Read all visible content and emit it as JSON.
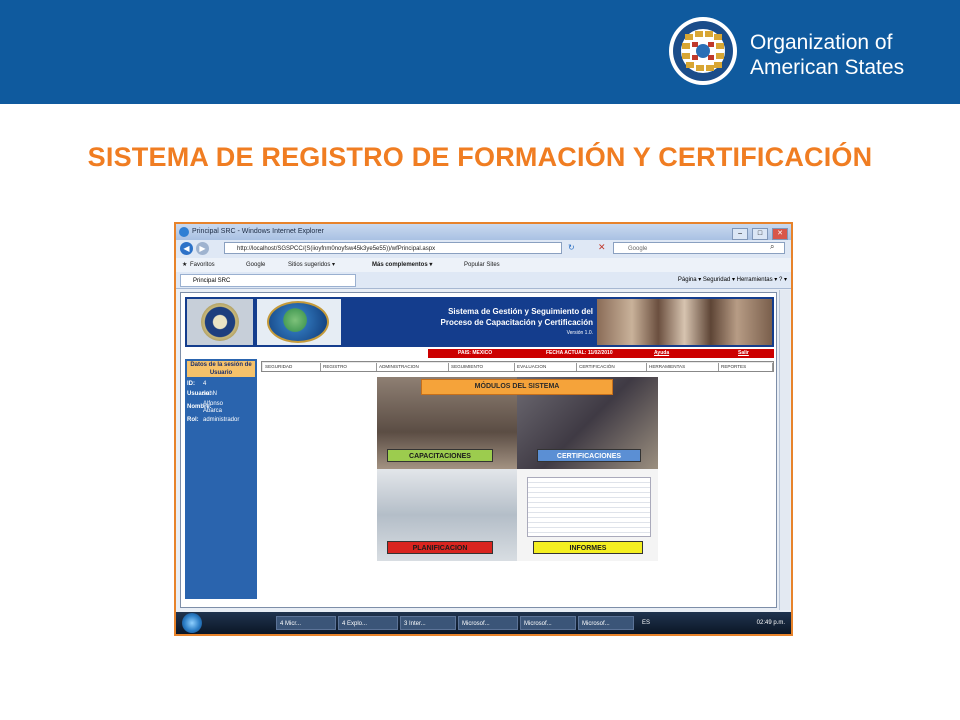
{
  "banner": {
    "org_line1": "Organization of",
    "org_line2": "American States"
  },
  "slide": {
    "title": "SISTEMA DE REGISTRO DE FORMACIÓN Y CERTIFICACIÓN"
  },
  "browser": {
    "window_title": "Principal SRC - Windows Internet Explorer",
    "window_buttons": [
      "–",
      "□",
      "✕"
    ],
    "url": "http://localhost/SGSPCC/(S(iioyfnm0noyfsw45k3ye5e55))/wfPrincipal.aspx",
    "search_placeholder": "Google",
    "favorites_bar": {
      "favoritos": "Favoritos",
      "google": "Google",
      "sitios": "Sitios sugeridos ▾",
      "mas": "Más complementos ▾",
      "popular": "Popular Sites"
    },
    "tab_label": "Principal SRC",
    "command_bar": "Página ▾   Seguridad ▾   Herramientas ▾   ? ▾"
  },
  "app": {
    "header_line1": "Sistema de Gestión y Seguimiento del",
    "header_line2": "Proceso de Capacitación y Certificación",
    "version": "Versión 1.0.",
    "country": "PAIS: MEXICO",
    "current_date": "FECHA ACTUAL: 11/02/2010",
    "help": "Ayuda",
    "exit": "Salir",
    "session_title": "Datos de la sesión de Usuario",
    "session": [
      {
        "label": "ID:",
        "value": "4"
      },
      {
        "label": "Usuario:",
        "value": "sahN"
      },
      {
        "label": "Nombre:",
        "value": "Alfonso Abarca"
      },
      {
        "label": "Rol:",
        "value": "administrador"
      }
    ],
    "menu": [
      "SEGURIDAD",
      "REGISTRO",
      "ADMINISTRACION",
      "SEGUIMIENTO",
      "EVALUACION",
      "CERTIFICACIÓN",
      "HERRAMIENTAS",
      "REPORTES"
    ],
    "modules_title": "MÓDULOS DEL SISTEMA",
    "modules": {
      "capacitaciones": "CAPACITACIONES",
      "certificaciones": "CERTIFICACIONES",
      "planificacion": "PLANIFICACION",
      "informes": "INFORMES"
    }
  },
  "taskbar": {
    "items": [
      "4 Micr...",
      "4 Explo...",
      "3 Inter...",
      "Microsof...",
      "Microsof...",
      "Microsof..."
    ],
    "lang": "ES",
    "clock": "02:49 p.m."
  }
}
